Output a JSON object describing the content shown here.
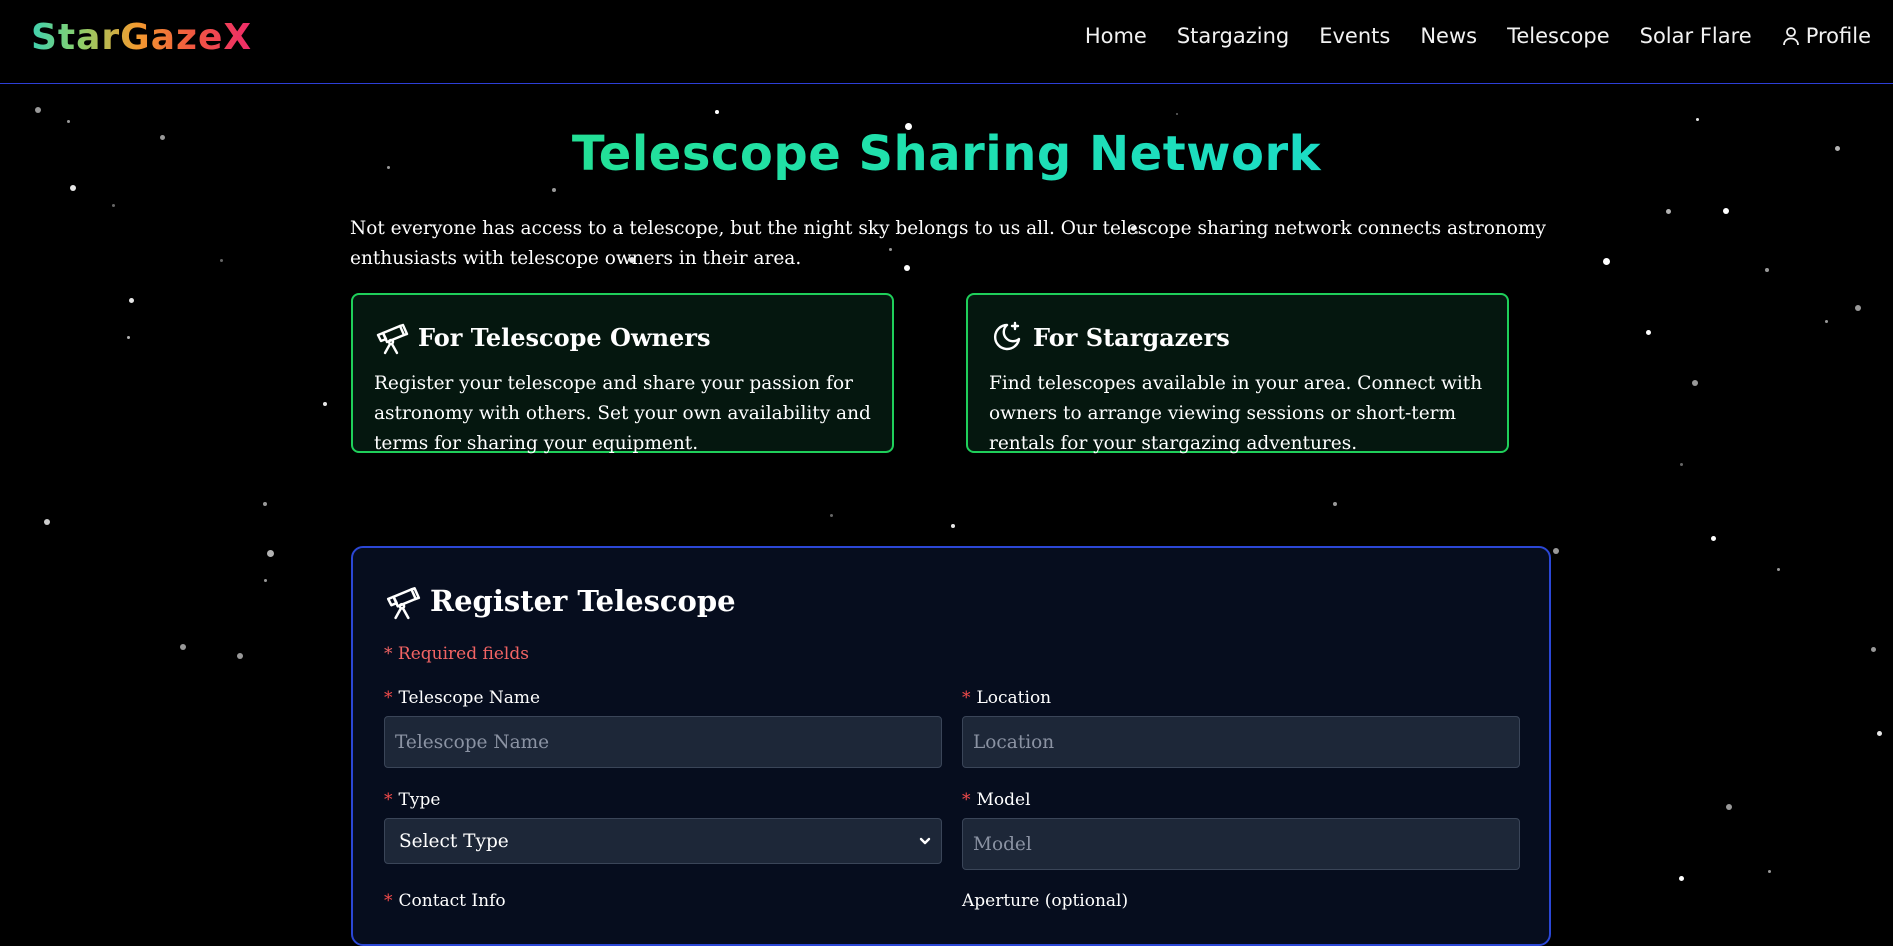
{
  "nav": {
    "logo": "StarGazeX",
    "links": [
      "Home",
      "Stargazing",
      "Events",
      "News",
      "Telescope",
      "Solar Flare",
      "Profile"
    ]
  },
  "page": {
    "title": "Telescope Sharing Network",
    "intro": "Not everyone has access to a telescope, but the night sky belongs to us all. Our telescope sharing network connects astronomy enthusiasts with telescope owners in their area."
  },
  "cards": [
    {
      "title": "For Telescope Owners",
      "icon": "telescope-icon",
      "text": "Register your telescope and share your passion for astronomy with others. Set your own availability and terms for sharing your equipment."
    },
    {
      "title": "For Stargazers",
      "icon": "moon-star-icon",
      "text": "Find telescopes available in your area. Connect with owners to arrange viewing sessions or short-term rentals for your stargazing adventures."
    }
  ],
  "form": {
    "title": "Register Telescope",
    "required_note": "* Required fields",
    "required_marker": "*",
    "fields": {
      "name": {
        "label": "Telescope Name",
        "placeholder": "Telescope Name"
      },
      "location": {
        "label": "Location",
        "placeholder": "Location"
      },
      "type": {
        "label": "Type",
        "value": "Select Type"
      },
      "model": {
        "label": "Model",
        "placeholder": "Model"
      },
      "contact": {
        "label": "Contact Info"
      },
      "aperture": {
        "label": "Aperture (optional)"
      }
    }
  },
  "colors": {
    "accent_green": "#1fcf5a",
    "accent_blue": "#2b47d6",
    "required_red": "#f24b4b"
  }
}
